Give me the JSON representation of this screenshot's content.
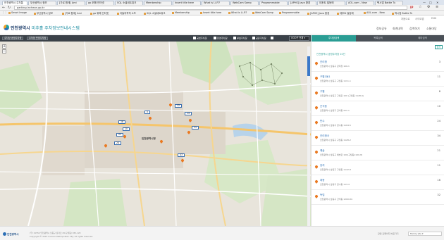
{
  "browser": {
    "tabs": [
      {
        "label": "인천광역시 주차통"
      },
      {
        "label": "Smart Image"
      },
      {
        "label": "부산광역시 정보"
      },
      {
        "label": "[가로 합계] Ami"
      },
      {
        "label": "go 위해 인터넷"
      },
      {
        "label": "SQL 소셜네트워크"
      },
      {
        "label": "Membership"
      },
      {
        "label": "Insert title here"
      },
      {
        "label": "What is Li-Fi?"
      },
      {
        "label": "WebCam Samp"
      },
      {
        "label": "Programmable"
      },
      {
        "label": "[APHS] Java 환경"
      },
      {
        "label": "데후트 빌등에"
      },
      {
        "label": "AOL.com - New"
      },
      {
        "label": "택시업 Battle Tu"
      }
    ],
    "url": "parking.incheon.go.kr",
    "ip_badge": "IP",
    "bookmarks": [
      "Smart Image",
      "부산광역시 정보",
      "[가로 합계] Ami",
      "go 위해 인터넷",
      "아들의목적 소프",
      "SQL 소셜네트워크",
      "Membership",
      "Insert title here",
      "What is Li-Fi?",
      "WebCam Samp",
      "Programmable",
      "[APHS] Java 환경",
      "데후트 빌등에",
      "AOL.com - New",
      "택시업 Battle Tu"
    ]
  },
  "util": {
    "home": "처음으로",
    "sitemap": "사이트맵",
    "lang": "ENG"
  },
  "header": {
    "logo_main": "인천광역시",
    "logo_sub": "미추홀 주차정보안내시스템",
    "nav": [
      "정보공유",
      "회계내역",
      "감액하기",
      "소통마당"
    ]
  },
  "toolbar": {
    "btn_public": "주차장 공영주차장",
    "btn_private": "주차장 민영주차장",
    "btn_parking_all": "공영주차장",
    "btn_parking_private": "민영주차장",
    "btn_parking_etc": "부설주차장",
    "btn_parking_shared": "공유주차장",
    "select_value": "OOO구 전체"
  },
  "map": {
    "district_label": "인천광역시청",
    "labels": [
      "5",
      "12",
      "14",
      "18",
      "11",
      "10",
      "21",
      "24",
      "43"
    ],
    "zoom_in": "+",
    "zoom_out": "−"
  },
  "sidebar": {
    "tabs": [
      "주차장검색",
      "목록검색",
      "테마검색"
    ],
    "close_label": "닫기",
    "results_header": "인천광역시 공영주차장 10건",
    "items": [
      {
        "name": "관리청",
        "addr": "인천광역시 남동구 관리청 100-1",
        "count": "3"
      },
      {
        "name": "구월1동1",
        "addr": "인천광역시 남동구 구월동 1111-1",
        "count": "11"
      },
      {
        "name": "구월",
        "addr": "인천광역시 남동구 구월로 100 (구월동 1128-9)",
        "count": "8"
      },
      {
        "name": "간석동",
        "addr": "인천광역시 남동구 간석동 221-1",
        "count": "10"
      },
      {
        "name": "만수",
        "addr": "인천광역시 남동구 만수동 1104-5",
        "count": "24"
      },
      {
        "name": "관리청사",
        "addr": "인천광역시 남동구 구월동 1128-2",
        "count": "34"
      },
      {
        "name": "예술",
        "addr": "인천광역시 남동구 예술로 100(구월동1100-8)",
        "count": "21"
      },
      {
        "name": "장치",
        "addr": "인천광역시 남동구 구월동 1142-8",
        "count": "11"
      },
      {
        "name": "대동",
        "addr": "인천광역시 남동구 만수동 113-4",
        "count": "16"
      },
      {
        "name": "독립",
        "addr": "인천광역시 남동구 간석동 1200-84",
        "count": "32"
      }
    ]
  },
  "footer": {
    "logo": "인천광역시",
    "address": "(우) 21554 인천광역시 남동구 정각로 29(구월동) 032-120",
    "copyright": "Copyright © 2015 Incheon Metropolitan City. All rights reserved.",
    "link_label": "관련 홈페이지 바로가기",
    "site_select": "Family site"
  }
}
